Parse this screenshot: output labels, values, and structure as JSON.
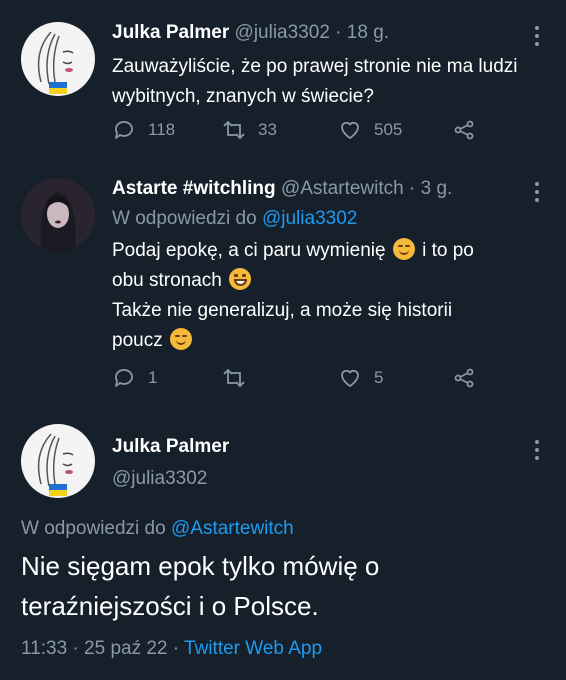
{
  "tweet1": {
    "name": "Julka Palmer",
    "handle": "@julia3302",
    "sep": "·",
    "time": "18 g.",
    "text": "Zauważyliście, że po prawej stronie nie ma ludzi wybitnych, znanych w świecie?",
    "replies": "118",
    "retweets": "33",
    "likes": "505"
  },
  "tweet2": {
    "name": "Astarte #witchling",
    "handle": "@Astartewitch",
    "sep": "·",
    "time": "3 g.",
    "reply_prefix": "W odpowiedzi do",
    "reply_to": "@julia3302",
    "line1a": "Podaj epokę, a ci paru wymienię",
    "line1b": "i to po",
    "line2": "obu stronach",
    "line3": "Także nie generalizuj, a może się historii",
    "line4": "poucz",
    "replies": "1",
    "retweets": "",
    "likes": "5"
  },
  "main_tweet": {
    "name": "Julka Palmer",
    "handle": "@julia3302",
    "reply_prefix": "W odpowiedzi do",
    "reply_to": "@Astartewitch",
    "text_line1": "Nie sięgam epok tylko mówię o",
    "text_line2": "teraźniejszości i o Polsce.",
    "time": "11:33",
    "sep1": "·",
    "date": "25 paź 22",
    "sep2": "·",
    "client": "Twitter Web App"
  },
  "icons": [
    "reply-icon",
    "retweet-icon",
    "like-icon",
    "share-icon",
    "more-icon",
    "ukraine-flag-icon"
  ],
  "colors": {
    "background": "#15202b",
    "muted": "#8b98a5",
    "link": "#1d9bf0"
  }
}
